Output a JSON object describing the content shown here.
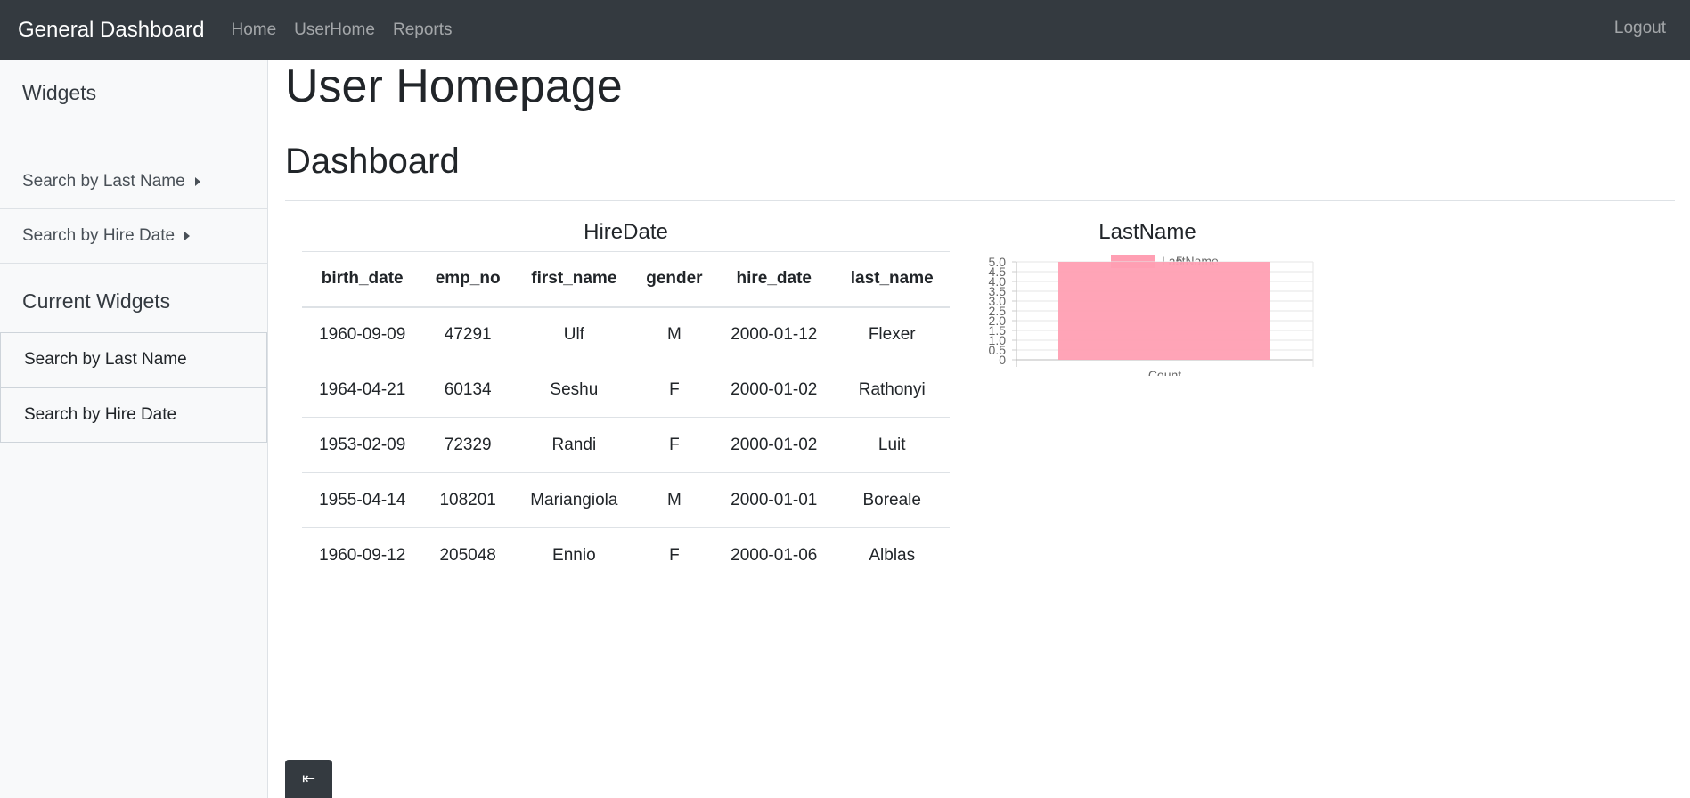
{
  "navbar": {
    "brand": "General Dashboard",
    "links": [
      "Home",
      "UserHome",
      "Reports"
    ],
    "logout": "Logout"
  },
  "sidebar": {
    "widgets_heading": "Widgets",
    "widget_items": [
      "Search by Last Name",
      "Search by Hire Date"
    ],
    "current_heading": "Current Widgets",
    "current_items": [
      "Search by Last Name",
      "Search by Hire Date"
    ]
  },
  "main": {
    "title": "User Homepage",
    "subtitle": "Dashboard"
  },
  "table_widget": {
    "title": "HireDate",
    "columns": [
      "birth_date",
      "emp_no",
      "first_name",
      "gender",
      "hire_date",
      "last_name"
    ],
    "rows": [
      [
        "1960-09-09",
        "47291",
        "Ulf",
        "M",
        "2000-01-12",
        "Flexer"
      ],
      [
        "1964-04-21",
        "60134",
        "Seshu",
        "F",
        "2000-01-02",
        "Rathonyi"
      ],
      [
        "1953-02-09",
        "72329",
        "Randi",
        "F",
        "2000-01-02",
        "Luit"
      ],
      [
        "1955-04-14",
        "108201",
        "Mariangiola",
        "M",
        "2000-01-01",
        "Boreale"
      ],
      [
        "1960-09-12",
        "205048",
        "Ennio",
        "F",
        "2000-01-06",
        "Alblas"
      ]
    ]
  },
  "chart_widget": {
    "title": "LastName"
  },
  "chart_data": {
    "type": "bar",
    "categories": [
      "Count"
    ],
    "series": [
      {
        "name": "LastName",
        "values": [
          5
        ]
      }
    ],
    "bar_color": "#ff9fb3",
    "overlay_label": "5",
    "ylim": [
      0,
      5
    ],
    "yticks": [
      "5.0",
      "4.5",
      "4.0",
      "3.5",
      "3.0",
      "2.5",
      "2.0",
      "1.5",
      "1.0",
      "0.5",
      "0"
    ],
    "xlabel": "Count",
    "legend": "top",
    "grid": true
  },
  "collapse_button": {
    "label": "⇤"
  },
  "colors": {
    "navbar_bg": "#343a40",
    "sidebar_bg": "#f8f9fa",
    "bar_fill": "#ff9fb3"
  }
}
